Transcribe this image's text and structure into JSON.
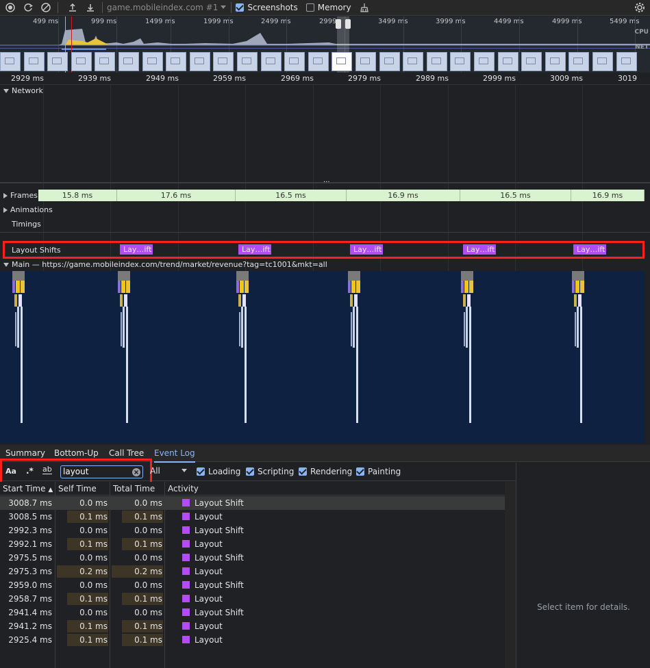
{
  "toolbar": {
    "url_label": "game.mobileindex.com #1",
    "screenshots_label": "Screenshots",
    "screenshots_checked": true,
    "memory_label": "Memory",
    "memory_checked": false
  },
  "overview": {
    "ticks": [
      "499 ms",
      "999 ms",
      "1499 ms",
      "1999 ms",
      "2499 ms",
      "2999",
      "3499 ms",
      "3999 ms",
      "4499 ms",
      "4999 ms",
      "5499 ms"
    ],
    "cpu_label": "CPU",
    "net_label": "NET"
  },
  "ruler": {
    "ticks": [
      "2929 ms",
      "2939 ms",
      "2949 ms",
      "2959 ms",
      "2969 ms",
      "2979 ms",
      "2989 ms",
      "2999 ms",
      "3009 ms",
      "3019 ms"
    ]
  },
  "tracks": {
    "network_label": "Network",
    "frames_label": "Frames",
    "frames": [
      "15.8 ms",
      "17.6 ms",
      "16.5 ms",
      "16.9 ms",
      "16.5 ms",
      "16.9 ms"
    ],
    "animations_label": "Animations",
    "timings_label": "Timings",
    "layout_shifts_label": "Layout Shifts",
    "layout_shift_block": "Lay…ift",
    "main_label": "Main — https://game.mobileindex.com/trend/market/revenue?tag=tc1001&mkt=all"
  },
  "tabs": [
    "Summary",
    "Bottom-Up",
    "Call Tree",
    "Event Log"
  ],
  "active_tab": "Event Log",
  "filter": {
    "match_case": "Aa",
    "regex": ".*",
    "whole_word": "ab",
    "search_value": "layout",
    "duration_select": "All",
    "categories": [
      {
        "label": "Loading",
        "checked": true
      },
      {
        "label": "Scripting",
        "checked": true
      },
      {
        "label": "Rendering",
        "checked": true
      },
      {
        "label": "Painting",
        "checked": true
      }
    ]
  },
  "table": {
    "headers": [
      "Start Time",
      "Self Time",
      "Total Time",
      "Activity"
    ],
    "rows": [
      {
        "start": "3008.7 ms",
        "self": "0.0 ms",
        "total": "0.0 ms",
        "activity": "Layout Shift"
      },
      {
        "start": "3008.5 ms",
        "self": "0.1 ms",
        "total": "0.1 ms",
        "activity": "Layout"
      },
      {
        "start": "2992.3 ms",
        "self": "0.0 ms",
        "total": "0.0 ms",
        "activity": "Layout Shift"
      },
      {
        "start": "2992.1 ms",
        "self": "0.1 ms",
        "total": "0.1 ms",
        "activity": "Layout"
      },
      {
        "start": "2975.5 ms",
        "self": "0.0 ms",
        "total": "0.0 ms",
        "activity": "Layout Shift"
      },
      {
        "start": "2975.3 ms",
        "self": "0.2 ms",
        "total": "0.2 ms",
        "activity": "Layout"
      },
      {
        "start": "2959.0 ms",
        "self": "0.0 ms",
        "total": "0.0 ms",
        "activity": "Layout Shift"
      },
      {
        "start": "2958.7 ms",
        "self": "0.1 ms",
        "total": "0.1 ms",
        "activity": "Layout"
      },
      {
        "start": "2941.4 ms",
        "self": "0.0 ms",
        "total": "0.0 ms",
        "activity": "Layout Shift"
      },
      {
        "start": "2941.2 ms",
        "self": "0.1 ms",
        "total": "0.1 ms",
        "activity": "Layout"
      },
      {
        "start": "2925.4 ms",
        "self": "0.1 ms",
        "total": "0.1 ms",
        "activity": "Layout"
      }
    ]
  },
  "details_placeholder": "Select item for details.",
  "colors": {
    "accent": "#8ab4f8",
    "layout_purple": "#b04df4",
    "highlight_red": "#ff1f1f",
    "frame_green": "#d9f2d0"
  }
}
